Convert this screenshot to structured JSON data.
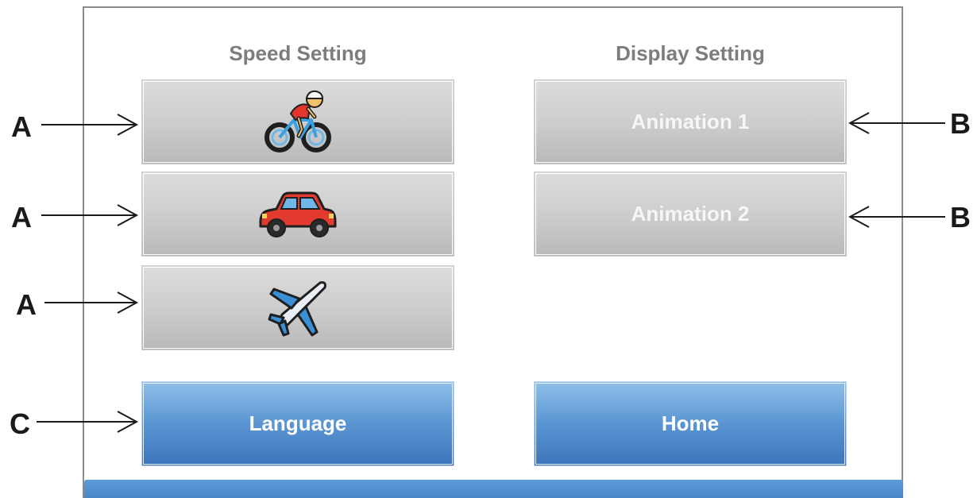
{
  "titles": {
    "speed": "Speed Setting",
    "display": "Display Setting"
  },
  "speed_buttons": [
    {
      "icon": "bicycle-icon"
    },
    {
      "icon": "car-icon"
    },
    {
      "icon": "airplane-icon"
    }
  ],
  "display_buttons": {
    "animation1": "Animation 1",
    "animation2": "Animation 2"
  },
  "bottom_buttons": {
    "language": "Language",
    "home": "Home"
  },
  "callouts": {
    "a1": "A",
    "a2": "A",
    "a3": "A",
    "b1": "B",
    "b2": "B",
    "c": "C"
  },
  "colors": {
    "gray_button": "#c8c8c8",
    "blue_button": "#4a86c6",
    "title_text": "#7d7d7d",
    "footer_bar": "#5592d0"
  }
}
